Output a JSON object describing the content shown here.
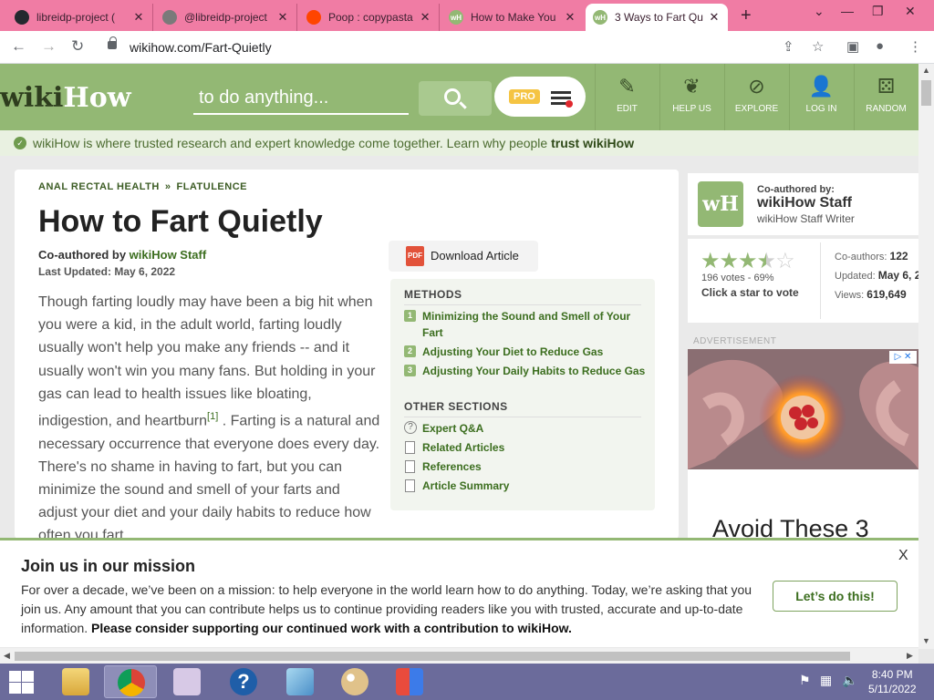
{
  "browser": {
    "tabs": [
      {
        "title": "libreidp-project (",
        "favicon": "github-icon",
        "color": "#24292f"
      },
      {
        "title": "@libreidp-project",
        "favicon": "globe-icon",
        "color": "#7a7a7a"
      },
      {
        "title": "Poop : copypasta",
        "favicon": "reddit-icon",
        "color": "#ff4500"
      },
      {
        "title": "How to Make You",
        "favicon": "wikihow-icon",
        "color": "#93b874"
      },
      {
        "title": "3 Ways to Fart Qu",
        "favicon": "wikihow-icon",
        "color": "#93b874"
      }
    ],
    "url": "wikihow.com/Fart-Quietly"
  },
  "header": {
    "logo_a": "wiki",
    "logo_b": "How",
    "search_placeholder": "to do anything...",
    "pro": "PRO",
    "nav": [
      {
        "label": "EDIT",
        "icon": "pencil-icon"
      },
      {
        "label": "HELP US",
        "icon": "sprout-icon"
      },
      {
        "label": "EXPLORE",
        "icon": "compass-icon"
      },
      {
        "label": "LOG IN",
        "icon": "user-icon"
      },
      {
        "label": "RANDOM",
        "icon": "dice-icon"
      }
    ]
  },
  "trust_bar": {
    "text": "wikiHow is where trusted research and expert knowledge come together. Learn why people ",
    "link": "trust wikiHow"
  },
  "article": {
    "breadcrumb": [
      "ANAL RECTAL HEALTH",
      "»",
      "FLATULENCE"
    ],
    "title": "How to Fart Quietly",
    "coauthored_label": "Co-authored by ",
    "coauthor": "wikiHow Staff",
    "last_updated": "Last Updated: May 6, 2022",
    "intro_before": "Though farting loudly may have been a big hit when you were a kid, in the adult world, farting loudly usually won't help you make any friends -- and it usually won't win you many fans. But holding in your gas can lead to health issues like bloating, indigestion, and heartburn",
    "ref": "[1]",
    "intro_after": " . Farting is a natural and necessary occurrence that everyone does every day. There's no shame in having to fart, but you can minimize the sound and smell of your farts and adjust your diet and your daily habits to reduce how often you fart.",
    "pdf_label": "PDF",
    "download": "Download Article"
  },
  "toc": {
    "methods_heading": "METHODS",
    "methods": [
      {
        "num": "1",
        "label": "Minimizing the Sound and Smell of Your Fart"
      },
      {
        "num": "2",
        "label": "Adjusting Your Diet to Reduce Gas"
      },
      {
        "num": "3",
        "label": "Adjusting Your Daily Habits to Reduce Gas"
      }
    ],
    "other_heading": "OTHER SECTIONS",
    "other": [
      {
        "label": "Expert Q&A",
        "icon": "question-icon"
      },
      {
        "label": "Related Articles",
        "icon": "document-icon"
      },
      {
        "label": "References",
        "icon": "page-icon"
      },
      {
        "label": "Article Summary",
        "icon": "document-icon"
      }
    ]
  },
  "sidebar": {
    "badge": "wH",
    "coauthored_by": "Co-authored by:",
    "name": "wikiHow Staff",
    "role": "wikiHow Staff Writer",
    "rating": 3.5,
    "votes": "196 votes - 69%",
    "click_to_vote": "Click a star to vote",
    "coauthors_label": "Co-authors: ",
    "coauthors": "122",
    "updated_label": "Updated: ",
    "updated": "May 6, 2",
    "views_label": "Views: ",
    "views": "619,649",
    "advertisement": "ADVERTISEMENT",
    "ad_headline": "Avoid These 3"
  },
  "banner": {
    "title": "Join us in our mission",
    "text": "For over a decade, we’ve been on a mission: to help everyone in the world learn how to do anything. Today, we’re asking that you join us. Any amount that you can contribute helps us to continue providing readers like you with trusted, accurate and up-to-date information. ",
    "bold": "Please consider supporting our continued work with a contribution to wikiHow.",
    "button": "Let’s do this!",
    "close": "X"
  },
  "taskbar": {
    "time": "8:40 PM",
    "date": "5/11/2022"
  }
}
